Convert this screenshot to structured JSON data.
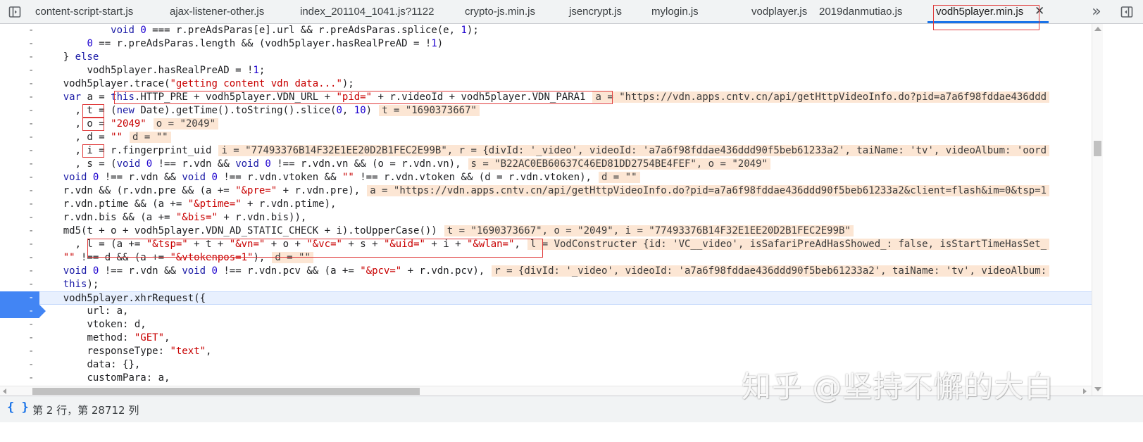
{
  "tabs": [
    {
      "label": "content-script-start.js"
    },
    {
      "label": "ajax-listener-other.js"
    },
    {
      "label": "index_201104_1041.js?1122"
    },
    {
      "label": "crypto-js.min.js"
    },
    {
      "label": "jsencrypt.js"
    },
    {
      "label": "mylogin.js"
    },
    {
      "label": "vodplayer.js"
    },
    {
      "label": "2019danmutiao.js"
    },
    {
      "label": "vodh5player.min.js",
      "active": true
    }
  ],
  "tab_close_glyph": "✕",
  "overflow_glyph": "»",
  "gutter_marker": "-",
  "status": {
    "position_text": "第 2 行，第 28712 列",
    "format_glyph": "{ }"
  },
  "watermark": "知乎 @坚持不懈的大白",
  "code_lines": [
    {
      "indent": "            ",
      "text": "void 0 === r.preAdsParas[e].url && r.preAdsParas.splice(e, 1);",
      "value": ""
    },
    {
      "indent": "        ",
      "text": "0 == r.preAdsParas.length && (vodh5player.hasRealPreAD = !1)",
      "value": ""
    },
    {
      "indent": "    ",
      "text": "} else",
      "value": ""
    },
    {
      "indent": "        ",
      "text": "vodh5player.hasRealPreAD = !1;",
      "value": ""
    },
    {
      "indent": "    ",
      "text": "vodh5player.trace(\"getting content vdn data...\");",
      "value": ""
    },
    {
      "indent": "    ",
      "text": "var a = this.HTTP_PRE + vodh5player.VDN_URL + \"pid=\" + r.videoId + vodh5player.VDN_PARA1",
      "value": "a = \"https://vdn.apps.cntv.cn/api/getHttpVideoInfo.do?pid=a7a6f98fddae436ddd"
    },
    {
      "indent": "      ",
      "text": ", t = (new Date).getTime().toString().slice(0, 10)",
      "value": "t = \"1690373667\""
    },
    {
      "indent": "      ",
      "text": ", o = \"2049\"",
      "value": "o = \"2049\""
    },
    {
      "indent": "      ",
      "text": ", d = \"\"",
      "value": "d = \"\""
    },
    {
      "indent": "      ",
      "text": ", i = r.fingerprint_uid",
      "value": "i = \"77493376B14F32E1EE20D2B1FEC2E99B\", r = {divId: '_video', videoId: 'a7a6f98fddae436ddd90f5beb61233a2', taiName: 'tv', videoAlbum: 'oord"
    },
    {
      "indent": "      ",
      "text": ", s = (void 0 !== r.vdn && void 0 !== r.vdn.vn && (o = r.vdn.vn),",
      "value": "s = \"B22AC0EB60637C46ED81DD2754BE4FEF\", o = \"2049\""
    },
    {
      "indent": "    ",
      "text": "void 0 !== r.vdn && void 0 !== r.vdn.vtoken && \"\" !== r.vdn.vtoken && (d = r.vdn.vtoken),",
      "value": "d = \"\""
    },
    {
      "indent": "    ",
      "text": "r.vdn && (r.vdn.pre && (a += \"&pre=\" + r.vdn.pre),",
      "value": "a = \"https://vdn.apps.cntv.cn/api/getHttpVideoInfo.do?pid=a7a6f98fddae436ddd90f5beb61233a2&client=flash&im=0&tsp=1"
    },
    {
      "indent": "    ",
      "text": "r.vdn.ptime && (a += \"&ptime=\" + r.vdn.ptime),",
      "value": ""
    },
    {
      "indent": "    ",
      "text": "r.vdn.bis && (a += \"&bis=\" + r.vdn.bis)),",
      "value": ""
    },
    {
      "indent": "    ",
      "text": "md5(t + o + vodh5player.VDN_AD_STATIC_CHECK + i).toUpperCase())",
      "value": "t = \"1690373667\", o = \"2049\", i = \"77493376B14F32E1EE20D2B1FEC2E99B\""
    },
    {
      "indent": "      ",
      "text": ", l = (a += \"&tsp=\" + t + \"&vn=\" + o + \"&vc=\" + s + \"&uid=\" + i + \"&wlan=\",",
      "value": "l = VodConstructer {id: 'VC__video', isSafariPreAdHasShowed_: false, isStartTimeHasSet_"
    },
    {
      "indent": "    ",
      "text": "\"\" !== d && (a += \"&vtokenpos=1\"),",
      "value": "d = \"\""
    },
    {
      "indent": "    ",
      "text": "void 0 !== r.vdn && void 0 !== r.vdn.pcv && (a += \"&pcv=\" + r.vdn.pcv),",
      "value": "r = {divId: '_video', videoId: 'a7a6f98fddae436ddd90f5beb61233a2', taiName: 'tv', videoAlbum:"
    },
    {
      "indent": "    ",
      "text": "this);",
      "value": ""
    },
    {
      "indent": "    ",
      "text": "vodh5player.xhrRequest({",
      "value": ""
    },
    {
      "indent": "        ",
      "text": "url: a,",
      "value": ""
    },
    {
      "indent": "        ",
      "text": "vtoken: d,",
      "value": ""
    },
    {
      "indent": "        ",
      "text": "method: \"GET\",",
      "value": ""
    },
    {
      "indent": "        ",
      "text": "responseType: \"text\",",
      "value": ""
    },
    {
      "indent": "        ",
      "text": "data: {},",
      "value": ""
    },
    {
      "indent": "        ",
      "text": "customPara: a,",
      "value": ""
    }
  ],
  "colors": {
    "keyword": "#1a1aa6",
    "string": "#c80000",
    "number": "#1c00cf",
    "inline_value_bg": "#fce6d4",
    "breakpoint": "#4285f4",
    "exec_line_bg": "#e8f0fe",
    "annotation_red": "#e03b3b",
    "tab_indicator": "#1a73e8"
  }
}
